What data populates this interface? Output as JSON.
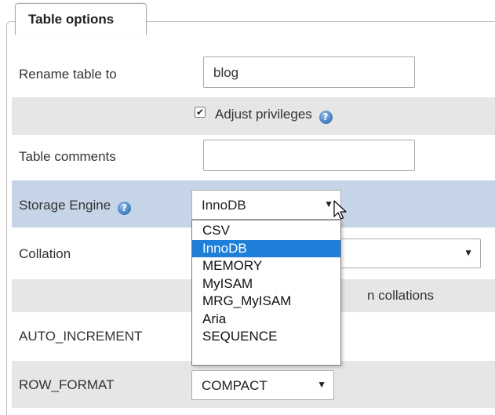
{
  "fieldset": {
    "legend": "Table options"
  },
  "rename": {
    "label": "Rename table to",
    "value": "blog"
  },
  "privileges": {
    "checked": true,
    "check_glyph": "✔",
    "label": "Adjust privileges",
    "help_icon": "help-icon"
  },
  "comments": {
    "label": "Table comments",
    "value": ""
  },
  "storage_engine": {
    "label": "Storage Engine",
    "selected": "InnoDB",
    "options": [
      "CSV",
      "InnoDB",
      "MEMORY",
      "MyISAM",
      "MRG_MyISAM",
      "Aria",
      "SEQUENCE"
    ],
    "highlighted_option": "InnoDB",
    "row_color": "#c5d5e7",
    "highlight_color": "#1e7fd8"
  },
  "collation": {
    "label": "Collation",
    "selected": ""
  },
  "collations_note": {
    "text": "n collations"
  },
  "auto_increment": {
    "label": "AUTO_INCREMENT"
  },
  "row_format": {
    "label": "ROW_FORMAT",
    "selected": "COMPACT"
  },
  "icons": {
    "help": "?",
    "dropdown_arrow": "▼"
  },
  "colors": {
    "shaded_row": "#e6e6e6"
  }
}
